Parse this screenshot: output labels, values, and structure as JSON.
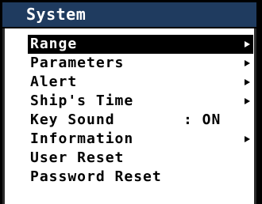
{
  "window": {
    "title": "System"
  },
  "menu": {
    "items": [
      {
        "label": "Range",
        "value": "",
        "has_submenu": true,
        "selected": true
      },
      {
        "label": "Parameters",
        "value": "",
        "has_submenu": true,
        "selected": false
      },
      {
        "label": "Alert",
        "value": "",
        "has_submenu": true,
        "selected": false
      },
      {
        "label": "Ship's Time",
        "value": "",
        "has_submenu": true,
        "selected": false
      },
      {
        "label": "Key Sound",
        "value": ": ON",
        "has_submenu": false,
        "selected": false
      },
      {
        "label": "Information",
        "value": "",
        "has_submenu": true,
        "selected": false
      },
      {
        "label": "User Reset",
        "value": "",
        "has_submenu": false,
        "selected": false
      },
      {
        "label": "Password Reset",
        "value": "",
        "has_submenu": false,
        "selected": false
      }
    ]
  },
  "colors": {
    "title_bar": "#1f3b5f",
    "panel": "#ffffff",
    "selection": "#000000"
  },
  "icons": {
    "submenu": "submenu-arrow-icon"
  }
}
